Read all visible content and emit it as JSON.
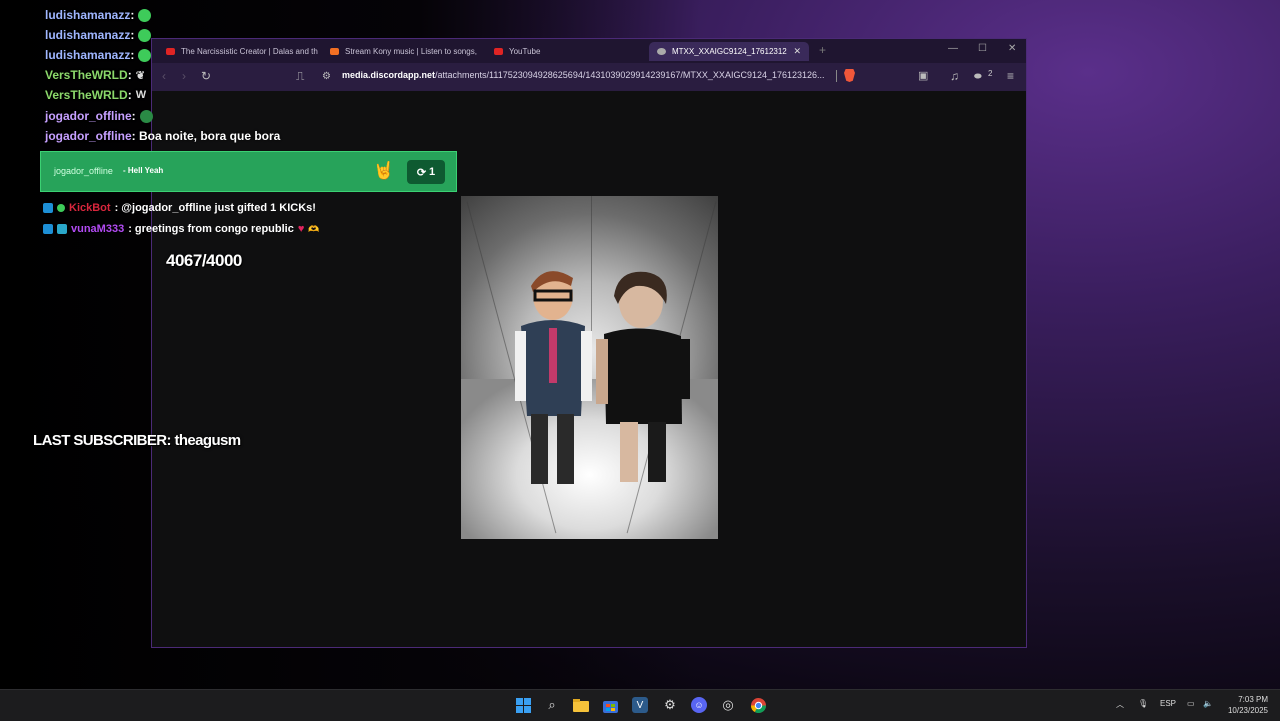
{
  "chat": [
    {
      "user": "ludishamanazz",
      "sep": " :",
      "color": "#9fb6ff"
    },
    {
      "user": "ludishamanazz",
      "sep": " :",
      "color": "#9fb6ff"
    },
    {
      "user": "ludishamanazz",
      "sep": " :",
      "color": "#9fb6ff"
    },
    {
      "user": "VersTheWRLD",
      "sep": " :",
      "color": "#8bd86b"
    },
    {
      "user": "VersTheWRLD",
      "sep": " :",
      "color": "#8bd86b"
    },
    {
      "user": "jogador_offline",
      "sep": " :",
      "color": "#c6a0ff"
    },
    {
      "user": "jogador_offline",
      "sep": " : Boa noite, bora que bora",
      "color": "#c6a0ff"
    }
  ],
  "sub_banner": {
    "user": "jogador_offline",
    "message": "- Hell Yeah",
    "count": "1"
  },
  "kickbot": {
    "user": "KickBot",
    "message": " : @jogador_offline just gifted 1 KICKs!"
  },
  "vuna": {
    "user": "vunaM333",
    "message": " : greetings from congo republic"
  },
  "goal_text": "4067/4000",
  "last_subscriber": "LAST SUBSCRIBER: theagusm",
  "browser": {
    "tabs": [
      {
        "label": "The Narcissistic Creator | Dalas and th",
        "favicon": "youtube-icon",
        "color": "#e02424"
      },
      {
        "label": "Stream Kony music | Listen to songs,",
        "favicon": "soundcloud-icon",
        "color": "#f26f23"
      },
      {
        "label": "YouTube",
        "favicon": "youtube-icon",
        "color": "#e02424"
      },
      {
        "label": "MTXX_XXAIGC9124_1761231269",
        "favicon": "globe-icon",
        "color": "#aaaaaa"
      }
    ],
    "url_host": "media.discordapp.net",
    "url_path": "/attachments/1117523094928625694/1431039029914239167/MTXX_XXAIGC9124_176123126...",
    "extensions_count": "2"
  },
  "taskbar": {
    "language": "ESP",
    "time": "7:03 PM",
    "date": "10/23/2025"
  },
  "colors": {
    "accent": "#27a35a",
    "window_border": "#4b2a77"
  }
}
